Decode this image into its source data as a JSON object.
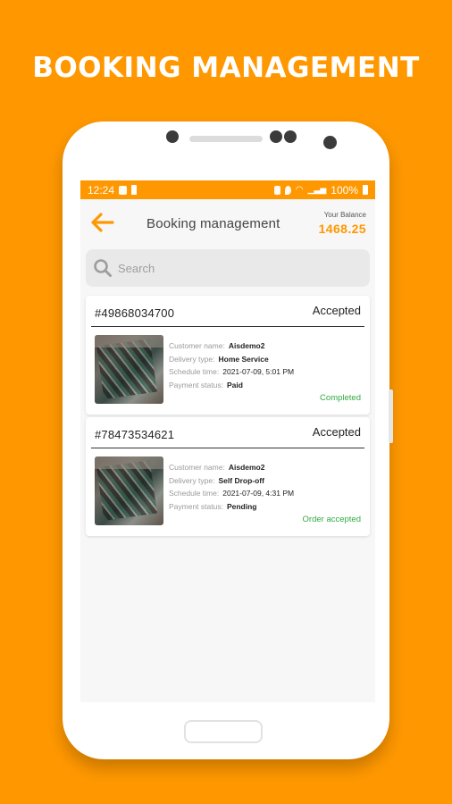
{
  "promo": {
    "title": "BOOKING MANAGEMENT"
  },
  "statusbar": {
    "time": "12:24",
    "battery_text": "100%"
  },
  "header": {
    "title": "Booking management",
    "balance_label": "Your Balance",
    "balance_value": "1468.25"
  },
  "search": {
    "placeholder": "Search"
  },
  "labels": {
    "customer_name": "Customer name:",
    "delivery_type": "Delivery type:",
    "schedule_time": "Schedule time:",
    "payment_status": "Payment status:"
  },
  "bookings": [
    {
      "id": "#49868034700",
      "status": "Accepted",
      "customer_name": "Aisdemo2",
      "delivery_type": "Home Service",
      "schedule_time": "2021-07-09, 5:01 PM",
      "payment_status": "Paid",
      "state": "Completed"
    },
    {
      "id": "#78473534621",
      "status": "Accepted",
      "customer_name": "Aisdemo2",
      "delivery_type": "Self Drop-off",
      "schedule_time": "2021-07-09, 4:31 PM",
      "payment_status": "Pending",
      "state": "Order accepted"
    }
  ],
  "colors": {
    "accent": "#FF9800",
    "success": "#33AA44"
  },
  "icons": {
    "back": "arrow-left-icon",
    "search": "search-icon"
  }
}
